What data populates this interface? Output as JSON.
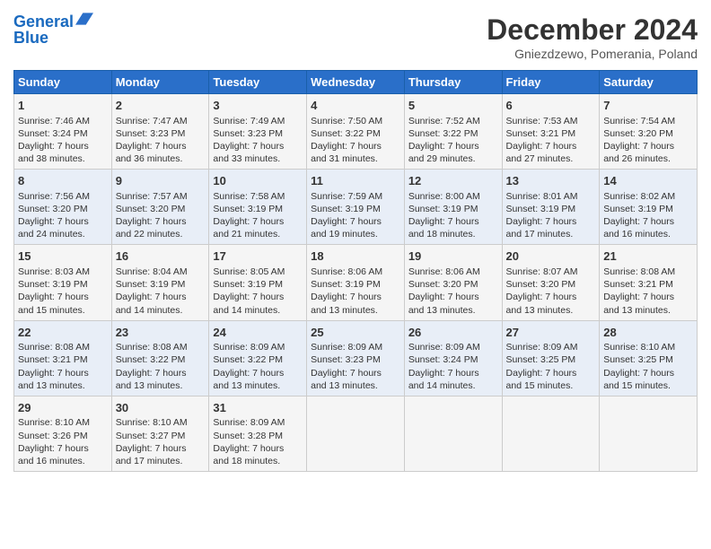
{
  "header": {
    "logo_line1": "General",
    "logo_line2": "Blue",
    "title": "December 2024",
    "subtitle": "Gniezdzewo, Pomerania, Poland"
  },
  "columns": [
    "Sunday",
    "Monday",
    "Tuesday",
    "Wednesday",
    "Thursday",
    "Friday",
    "Saturday"
  ],
  "weeks": [
    [
      {
        "day": "1",
        "lines": [
          "Sunrise: 7:46 AM",
          "Sunset: 3:24 PM",
          "Daylight: 7 hours",
          "and 38 minutes."
        ]
      },
      {
        "day": "2",
        "lines": [
          "Sunrise: 7:47 AM",
          "Sunset: 3:23 PM",
          "Daylight: 7 hours",
          "and 36 minutes."
        ]
      },
      {
        "day": "3",
        "lines": [
          "Sunrise: 7:49 AM",
          "Sunset: 3:23 PM",
          "Daylight: 7 hours",
          "and 33 minutes."
        ]
      },
      {
        "day": "4",
        "lines": [
          "Sunrise: 7:50 AM",
          "Sunset: 3:22 PM",
          "Daylight: 7 hours",
          "and 31 minutes."
        ]
      },
      {
        "day": "5",
        "lines": [
          "Sunrise: 7:52 AM",
          "Sunset: 3:22 PM",
          "Daylight: 7 hours",
          "and 29 minutes."
        ]
      },
      {
        "day": "6",
        "lines": [
          "Sunrise: 7:53 AM",
          "Sunset: 3:21 PM",
          "Daylight: 7 hours",
          "and 27 minutes."
        ]
      },
      {
        "day": "7",
        "lines": [
          "Sunrise: 7:54 AM",
          "Sunset: 3:20 PM",
          "Daylight: 7 hours",
          "and 26 minutes."
        ]
      }
    ],
    [
      {
        "day": "8",
        "lines": [
          "Sunrise: 7:56 AM",
          "Sunset: 3:20 PM",
          "Daylight: 7 hours",
          "and 24 minutes."
        ]
      },
      {
        "day": "9",
        "lines": [
          "Sunrise: 7:57 AM",
          "Sunset: 3:20 PM",
          "Daylight: 7 hours",
          "and 22 minutes."
        ]
      },
      {
        "day": "10",
        "lines": [
          "Sunrise: 7:58 AM",
          "Sunset: 3:19 PM",
          "Daylight: 7 hours",
          "and 21 minutes."
        ]
      },
      {
        "day": "11",
        "lines": [
          "Sunrise: 7:59 AM",
          "Sunset: 3:19 PM",
          "Daylight: 7 hours",
          "and 19 minutes."
        ]
      },
      {
        "day": "12",
        "lines": [
          "Sunrise: 8:00 AM",
          "Sunset: 3:19 PM",
          "Daylight: 7 hours",
          "and 18 minutes."
        ]
      },
      {
        "day": "13",
        "lines": [
          "Sunrise: 8:01 AM",
          "Sunset: 3:19 PM",
          "Daylight: 7 hours",
          "and 17 minutes."
        ]
      },
      {
        "day": "14",
        "lines": [
          "Sunrise: 8:02 AM",
          "Sunset: 3:19 PM",
          "Daylight: 7 hours",
          "and 16 minutes."
        ]
      }
    ],
    [
      {
        "day": "15",
        "lines": [
          "Sunrise: 8:03 AM",
          "Sunset: 3:19 PM",
          "Daylight: 7 hours",
          "and 15 minutes."
        ]
      },
      {
        "day": "16",
        "lines": [
          "Sunrise: 8:04 AM",
          "Sunset: 3:19 PM",
          "Daylight: 7 hours",
          "and 14 minutes."
        ]
      },
      {
        "day": "17",
        "lines": [
          "Sunrise: 8:05 AM",
          "Sunset: 3:19 PM",
          "Daylight: 7 hours",
          "and 14 minutes."
        ]
      },
      {
        "day": "18",
        "lines": [
          "Sunrise: 8:06 AM",
          "Sunset: 3:19 PM",
          "Daylight: 7 hours",
          "and 13 minutes."
        ]
      },
      {
        "day": "19",
        "lines": [
          "Sunrise: 8:06 AM",
          "Sunset: 3:20 PM",
          "Daylight: 7 hours",
          "and 13 minutes."
        ]
      },
      {
        "day": "20",
        "lines": [
          "Sunrise: 8:07 AM",
          "Sunset: 3:20 PM",
          "Daylight: 7 hours",
          "and 13 minutes."
        ]
      },
      {
        "day": "21",
        "lines": [
          "Sunrise: 8:08 AM",
          "Sunset: 3:21 PM",
          "Daylight: 7 hours",
          "and 13 minutes."
        ]
      }
    ],
    [
      {
        "day": "22",
        "lines": [
          "Sunrise: 8:08 AM",
          "Sunset: 3:21 PM",
          "Daylight: 7 hours",
          "and 13 minutes."
        ]
      },
      {
        "day": "23",
        "lines": [
          "Sunrise: 8:08 AM",
          "Sunset: 3:22 PM",
          "Daylight: 7 hours",
          "and 13 minutes."
        ]
      },
      {
        "day": "24",
        "lines": [
          "Sunrise: 8:09 AM",
          "Sunset: 3:22 PM",
          "Daylight: 7 hours",
          "and 13 minutes."
        ]
      },
      {
        "day": "25",
        "lines": [
          "Sunrise: 8:09 AM",
          "Sunset: 3:23 PM",
          "Daylight: 7 hours",
          "and 13 minutes."
        ]
      },
      {
        "day": "26",
        "lines": [
          "Sunrise: 8:09 AM",
          "Sunset: 3:24 PM",
          "Daylight: 7 hours",
          "and 14 minutes."
        ]
      },
      {
        "day": "27",
        "lines": [
          "Sunrise: 8:09 AM",
          "Sunset: 3:25 PM",
          "Daylight: 7 hours",
          "and 15 minutes."
        ]
      },
      {
        "day": "28",
        "lines": [
          "Sunrise: 8:10 AM",
          "Sunset: 3:25 PM",
          "Daylight: 7 hours",
          "and 15 minutes."
        ]
      }
    ],
    [
      {
        "day": "29",
        "lines": [
          "Sunrise: 8:10 AM",
          "Sunset: 3:26 PM",
          "Daylight: 7 hours",
          "and 16 minutes."
        ]
      },
      {
        "day": "30",
        "lines": [
          "Sunrise: 8:10 AM",
          "Sunset: 3:27 PM",
          "Daylight: 7 hours",
          "and 17 minutes."
        ]
      },
      {
        "day": "31",
        "lines": [
          "Sunrise: 8:09 AM",
          "Sunset: 3:28 PM",
          "Daylight: 7 hours",
          "and 18 minutes."
        ]
      },
      null,
      null,
      null,
      null
    ]
  ]
}
